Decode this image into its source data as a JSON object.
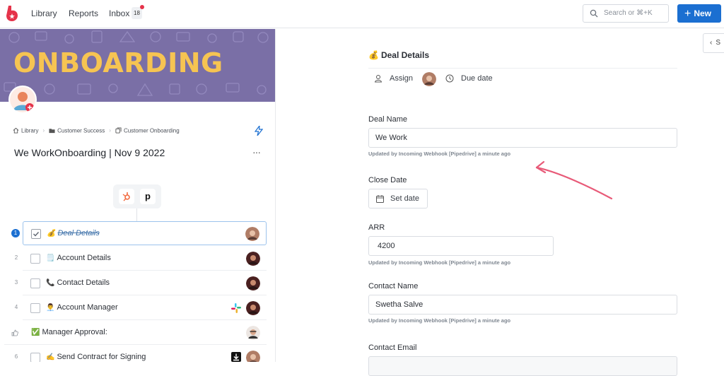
{
  "nav": {
    "library": "Library",
    "reports": "Reports",
    "inbox": "Inbox",
    "inbox_count": "18",
    "search_placeholder": "Search or ⌘+K",
    "new_label": "New"
  },
  "left": {
    "banner_title": "ONBOARDING",
    "breadcrumb": [
      "Library",
      "Customer Success",
      "Customer Onboarding"
    ],
    "doc_title": "We WorkOnboarding | Nov 9 2022",
    "more_label": "···",
    "steps": [
      {
        "num": "1",
        "label": "Deal Details",
        "emoji": "💰",
        "done": true
      },
      {
        "num": "2",
        "label": "Account Details",
        "emoji": "🗒️",
        "done": false
      },
      {
        "num": "3",
        "label": "Contact Details",
        "emoji": "📞",
        "done": false
      },
      {
        "num": "4",
        "label": "Account Manager",
        "emoji": "👨‍💼",
        "done": false
      },
      {
        "num": "",
        "label": "Manager Approval:",
        "emoji": "✅",
        "done": false
      },
      {
        "num": "6",
        "label": "Send Contract for Signing",
        "emoji": "✍️",
        "done": false
      }
    ]
  },
  "right": {
    "collapse_label": "S",
    "section_emoji": "💰",
    "section_title": "Deal Details",
    "assign_label": "Assign",
    "due_label": "Due date",
    "deal_name_label": "Deal Name",
    "deal_name_value": "We Work",
    "deal_name_hint": "Updated by Incoming Webhook [Pipedrive] a minute ago",
    "close_date_label": "Close Date",
    "set_date_label": "Set date",
    "arr_label": "ARR",
    "arr_value": "4200",
    "arr_hint": "Updated by Incoming Webhook [Pipedrive] a minute ago",
    "contact_name_label": "Contact Name",
    "contact_name_value": "Swetha Salve",
    "contact_name_hint": "Updated by Incoming Webhook [Pipedrive] a minute ago",
    "contact_email_label": "Contact Email"
  },
  "colors": {
    "brand": "#e5334a",
    "primary": "#1b6fd1",
    "banner_bg": "#7a6fa6",
    "banner_text": "#f6c452",
    "annotation": "#e85a78"
  },
  "icons": [
    "logo-icon",
    "search-icon",
    "plus-icon",
    "home-icon",
    "folder-icon",
    "copy-icon",
    "bolt-icon",
    "user-icon",
    "clock-icon",
    "calendar-icon",
    "chevron-left-icon",
    "hubspot-icon",
    "pipedrive-icon",
    "slack-icon",
    "download-icon"
  ]
}
